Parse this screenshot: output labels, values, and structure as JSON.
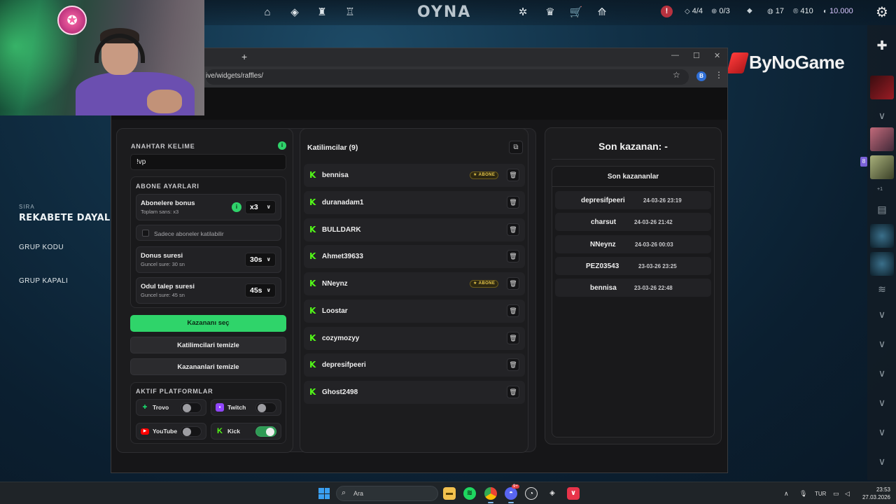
{
  "game": {
    "play_label": "OYNA",
    "nav_icons": [
      "home-icon",
      "career-icon",
      "agents-icon",
      "collection-icon",
      "battlepass-icon",
      "progress-icon",
      "store-icon",
      "rank-icon"
    ],
    "alert": "!",
    "party_count": "4/4",
    "queue_count": "0/3",
    "level": "17",
    "radianite": "410",
    "vp": "10.000",
    "menu": {
      "kicker": "SIRA",
      "mode": "REKABETE DAYALI",
      "group_code": "GRUP KODU",
      "group_closed": "GRUP KAPALI"
    },
    "social_more": "+1",
    "social_badge": "8"
  },
  "overlay": {
    "brand": "ByNoGame"
  },
  "browser": {
    "url": "ive/widgets/raffles/",
    "new_tab": "+",
    "avatar_letter": "B"
  },
  "raffle": {
    "keyword_label": "ANAHTAR KELIME",
    "keyword_value": "!vp",
    "sub_settings_label": "ABONE AYARLARI",
    "sub_bonus": {
      "title": "Abonelere bonus",
      "subtitle": "Toplam sans: x3",
      "value": "x3"
    },
    "sub_only_label": "Sadece aboneler katilabilir",
    "donus": {
      "title": "Donus suresi",
      "subtitle": "Guncel sure: 30 sn",
      "value": "30s"
    },
    "odul": {
      "title": "Odul talep suresi",
      "subtitle": "Guncel sure: 45 sn",
      "value": "45s"
    },
    "buttons": {
      "pick_winner": "Kazananı seç",
      "clear_participants": "Katilimcilari temizle",
      "clear_winners": "Kazananlari temizle"
    },
    "platforms_label": "AKTIF PLATFORMLAR",
    "platforms": [
      {
        "name": "Trovo",
        "enabled": false,
        "color": "#19d66b"
      },
      {
        "name": "Twitch",
        "enabled": false,
        "color": "#9146ff"
      },
      {
        "name": "YouTube",
        "enabled": false,
        "color": "#ff0000"
      },
      {
        "name": "Kick",
        "enabled": true,
        "color": "#53fc18"
      }
    ],
    "participants_title": "Katilimcilar (9)",
    "sub_badge_text": "★ ABONE",
    "participants": [
      {
        "name": "bennisa",
        "subscriber": true
      },
      {
        "name": "duranadam1",
        "subscriber": false
      },
      {
        "name": "BULLDARK",
        "subscriber": false
      },
      {
        "name": "Ahmet39633",
        "subscriber": false
      },
      {
        "name": "NNeynz",
        "subscriber": true
      },
      {
        "name": "Loostar",
        "subscriber": false
      },
      {
        "name": "cozymozyy",
        "subscriber": false
      },
      {
        "name": "depresifpeeri",
        "subscriber": false
      },
      {
        "name": "Ghost2498",
        "subscriber": false
      }
    ],
    "last_winner_heading": "Son kazanan: -",
    "winners_title": "Son kazananlar",
    "winners": [
      {
        "name": "depresifpeeri",
        "date": "24-03-26 23:19"
      },
      {
        "name": "charsut",
        "date": "24-03-26 21:42"
      },
      {
        "name": "NNeynz",
        "date": "24-03-26 00:03"
      },
      {
        "name": "PEZ03543",
        "date": "23-03-26 23:25"
      },
      {
        "name": "bennisa",
        "date": "23-03-26 22:48"
      }
    ]
  },
  "taskbar": {
    "search_placeholder": "Ara",
    "language": "TUR",
    "time": "23:53",
    "date": "27.03.2026",
    "discord_badge": "9+"
  }
}
